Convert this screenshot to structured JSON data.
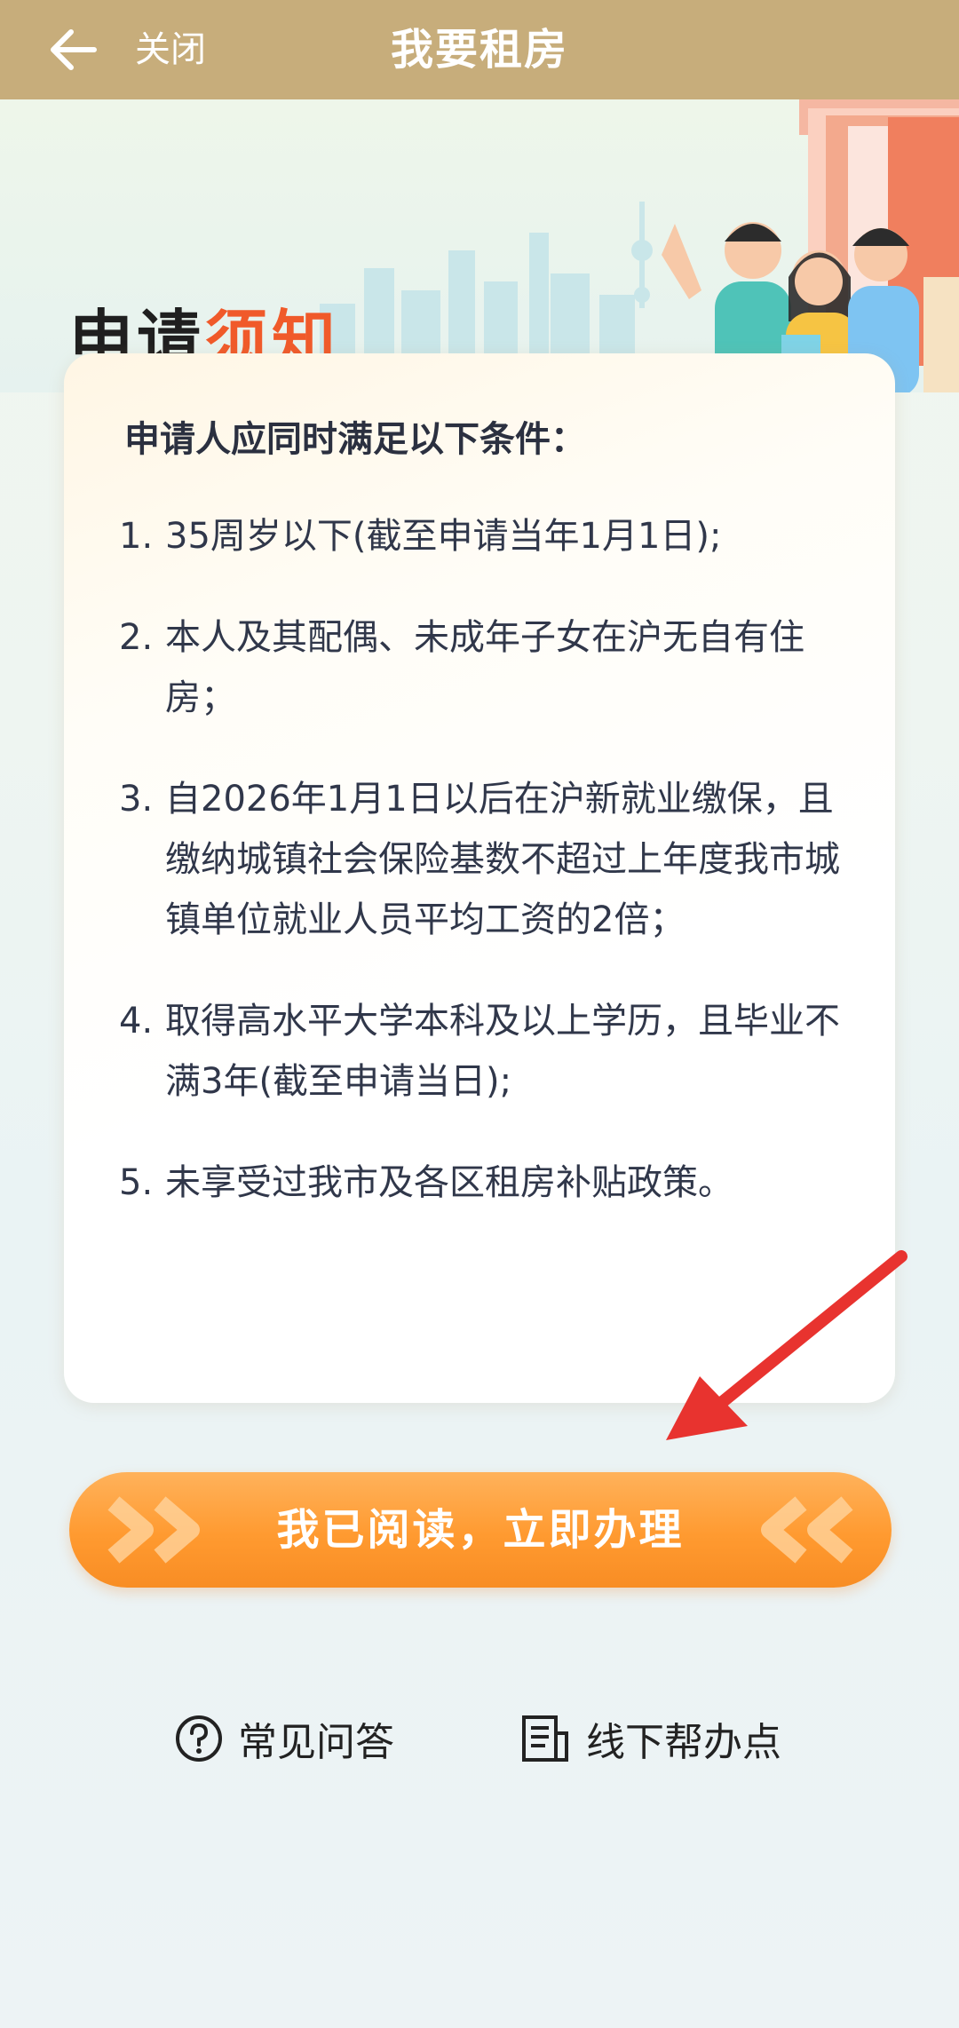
{
  "header": {
    "close_label": "关闭",
    "title": "我要租房"
  },
  "hero": {
    "title_dark": "申请",
    "title_orange": "须知"
  },
  "notice": {
    "heading": "申请人应同时满足以下条件：",
    "items": [
      {
        "num": "1.",
        "text": "35周岁以下(截至申请当年1月1日);"
      },
      {
        "num": "2.",
        "text": "本人及其配偶、未成年子女在沪无自有住房；"
      },
      {
        "num": "3.",
        "text": "自2026年1月1日以后在沪新就业缴保，且缴纳城镇社会保险基数不超过上年度我市城镇单位就业人员平均工资的2倍；"
      },
      {
        "num": "4.",
        "text": "取得高水平大学本科及以上学历，且毕业不满3年(截至申请当日);"
      },
      {
        "num": "5.",
        "text": "未享受过我市及各区租房补贴政策。"
      }
    ]
  },
  "cta": {
    "label": "我已阅读，立即办理"
  },
  "links": {
    "faq": "常见问答",
    "offline": "线下帮办点"
  },
  "colors": {
    "header": "#c7ad7b",
    "accent": "#f05a2a",
    "button": "#ff9a30",
    "annotation_arrow": "#e8332f"
  },
  "icons": {
    "back": "arrow-left-icon",
    "faq": "question-circle-icon",
    "offline": "document-building-icon"
  }
}
